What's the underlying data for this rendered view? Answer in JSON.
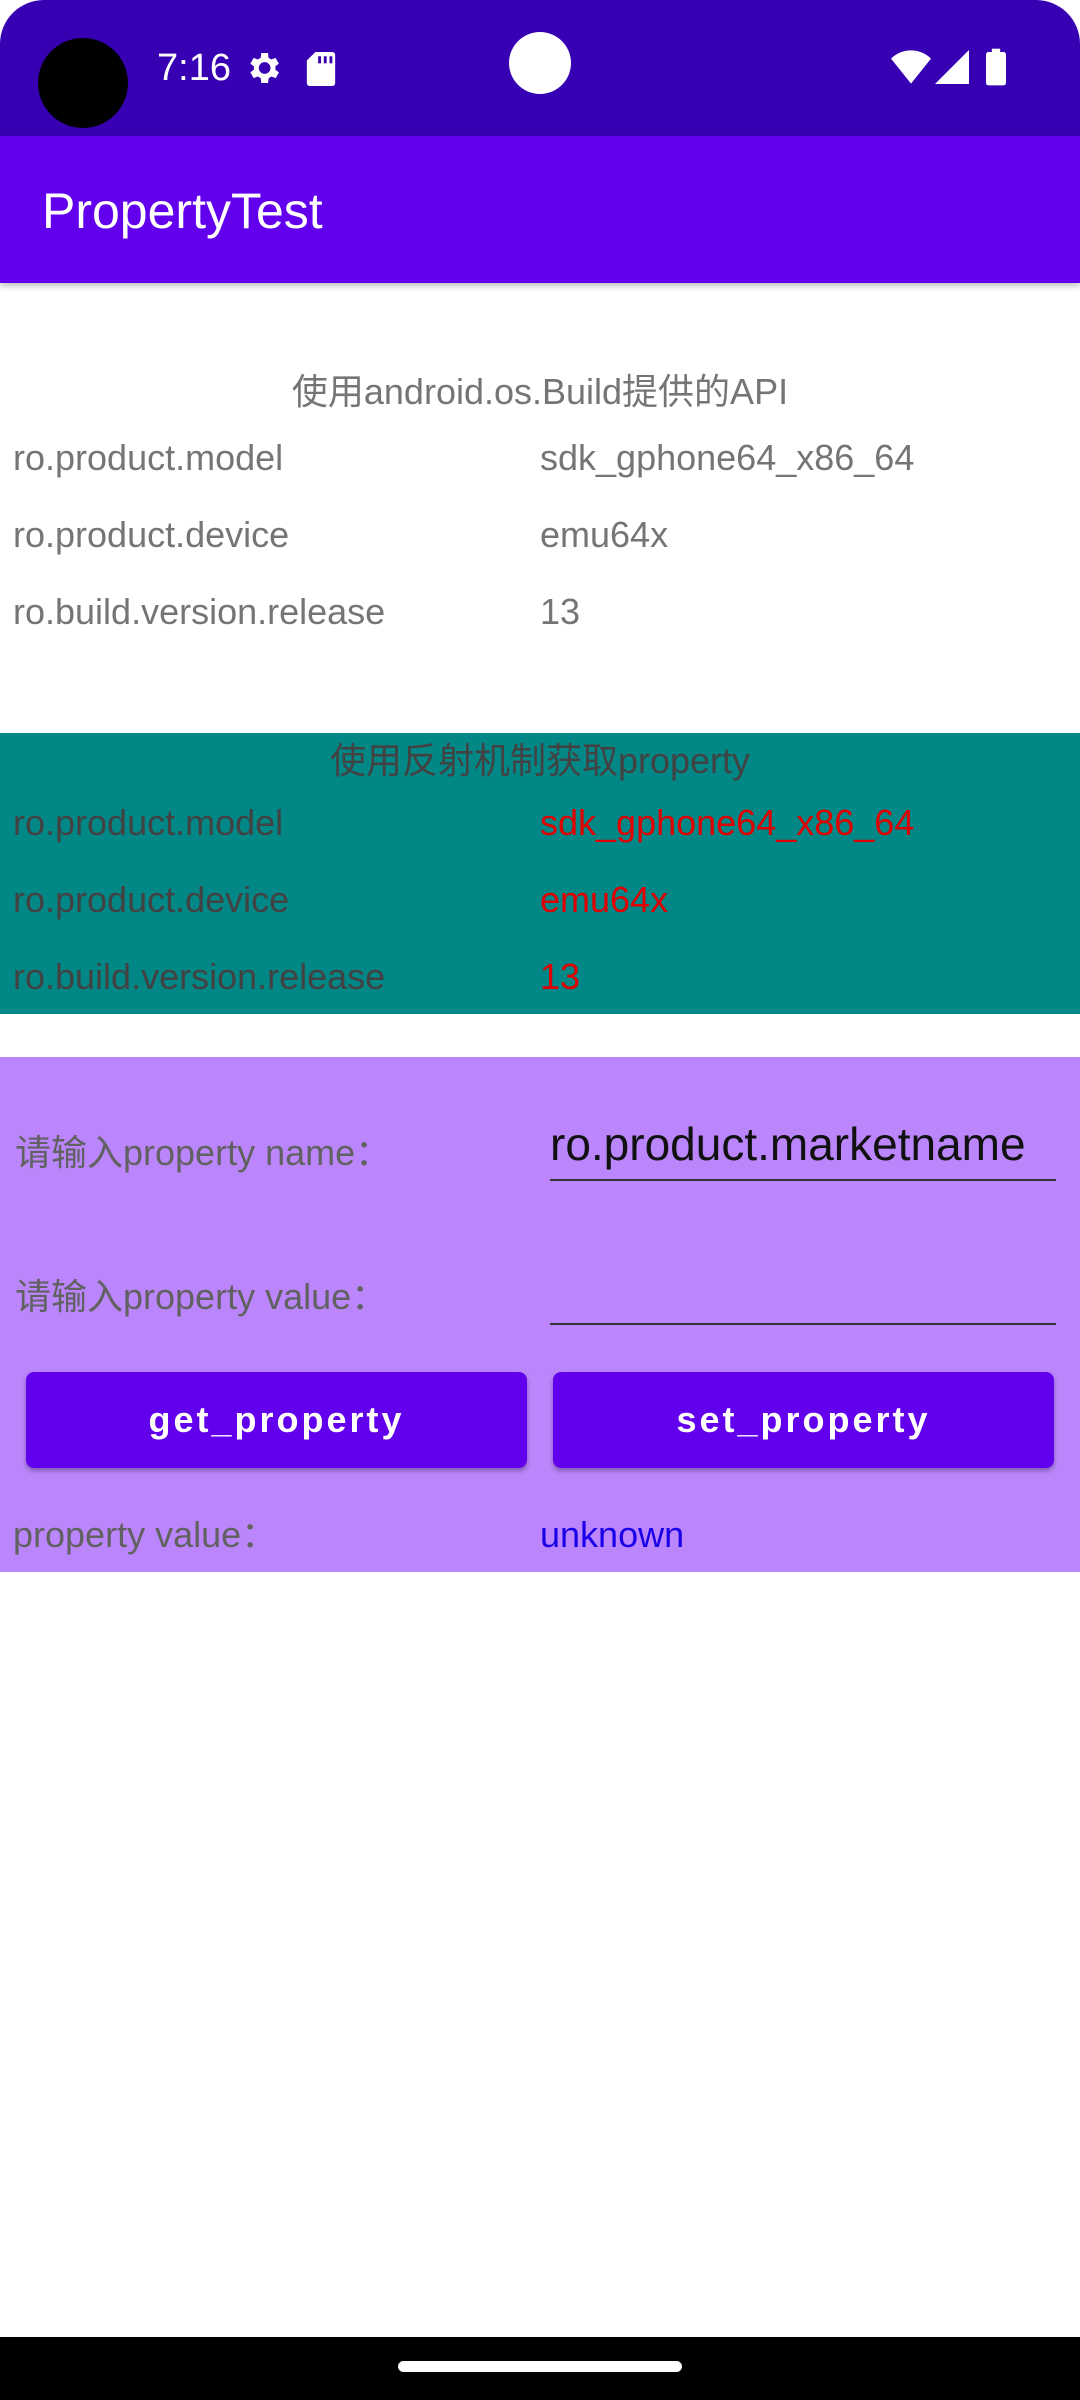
{
  "status_bar": {
    "time": "7:16",
    "icons": [
      "gear-icon",
      "sd-card-icon",
      "wifi-icon",
      "signal-icon",
      "battery-icon"
    ]
  },
  "app_bar": {
    "title": "PropertyTest"
  },
  "build_api_section": {
    "title": "使用android.os.Build提供的API",
    "rows": [
      {
        "key": "ro.product.model",
        "value": "sdk_gphone64_x86_64"
      },
      {
        "key": "ro.product.device",
        "value": "emu64x"
      },
      {
        "key": "ro.build.version.release",
        "value": "13"
      }
    ]
  },
  "reflection_section": {
    "title": "使用反射机制获取property",
    "rows": [
      {
        "key": "ro.product.model",
        "value": "sdk_gphone64_x86_64"
      },
      {
        "key": "ro.product.device",
        "value": "emu64x"
      },
      {
        "key": "ro.build.version.release",
        "value": "13"
      }
    ]
  },
  "property_form": {
    "name_label": "请输入property name：",
    "name_value": "ro.product.marketname",
    "value_label": "请输入property value：",
    "value_value": "",
    "get_button": "get_property",
    "set_button": "set_property",
    "result_label": "property value：",
    "result_value": "unknown"
  },
  "colors": {
    "status_bar": "#3700b3",
    "app_bar": "#6200ee",
    "reflection_bg": "#018786",
    "form_bg": "#bb86fc",
    "reflection_value": "#e00000",
    "result_value": "#1a00e8"
  }
}
